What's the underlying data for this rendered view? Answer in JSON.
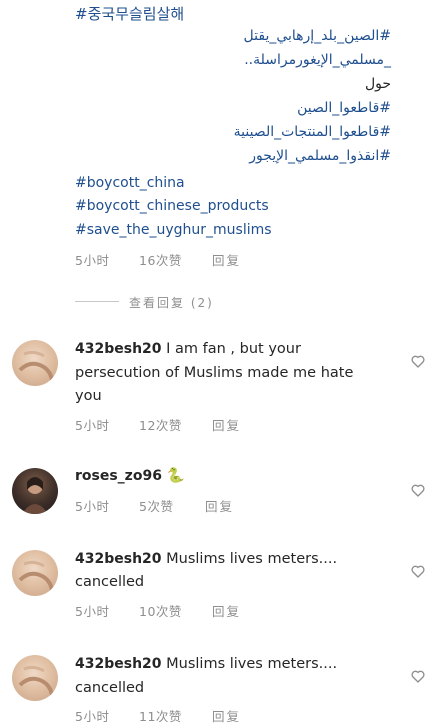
{
  "post_tags": {
    "korean_tag": "#중국무슬림살해",
    "arabic_line1": "#الصين_بلد_إرهابي_يقتل",
    "arabic_line2": "_مسلمي_الإيغورمراسلة..",
    "arabic_line3": "حول",
    "arabic_line4": "#قاطعوا_الصين",
    "arabic_line5": "#قاطعوا_المنتجات_الصينية",
    "arabic_line6": "#انقذوا_مسلمي_الإيجور",
    "en_tag1": "#boycott_china",
    "en_tag2": "#boycott_chinese_products",
    "en_tag3": "#save_the_uyghur_muslims",
    "time": "5小时",
    "likes": "16次赞",
    "reply": "回复"
  },
  "view_replies": "查看回复 (2)",
  "comments": [
    {
      "username": "432besh20",
      "line1": "I am fan , but your",
      "line2": "persecution of Muslims made me hate",
      "line3": "you",
      "time": "5小时",
      "likes": "12次赞",
      "reply": "回复"
    },
    {
      "username": "roses_zo96",
      "emoji": "🐍",
      "time": "5小时",
      "likes": "5次赞",
      "reply": "回复"
    },
    {
      "username": "432besh20",
      "line1": "Muslims lives meters....",
      "line2": "cancelled",
      "time": "5小时",
      "likes": "10次赞",
      "reply": "回复"
    },
    {
      "username": "432besh20",
      "line1": "Muslims lives meters....",
      "line2": "cancelled",
      "time": "5小时",
      "likes": "11次赞",
      "reply": "回复"
    }
  ],
  "colors": {
    "hashtag": "#1f4f8f",
    "meta": "#8e8e8e",
    "text": "#262626"
  },
  "icons": {
    "like": "heart-outline-icon",
    "emoji": "snake-emoji"
  }
}
